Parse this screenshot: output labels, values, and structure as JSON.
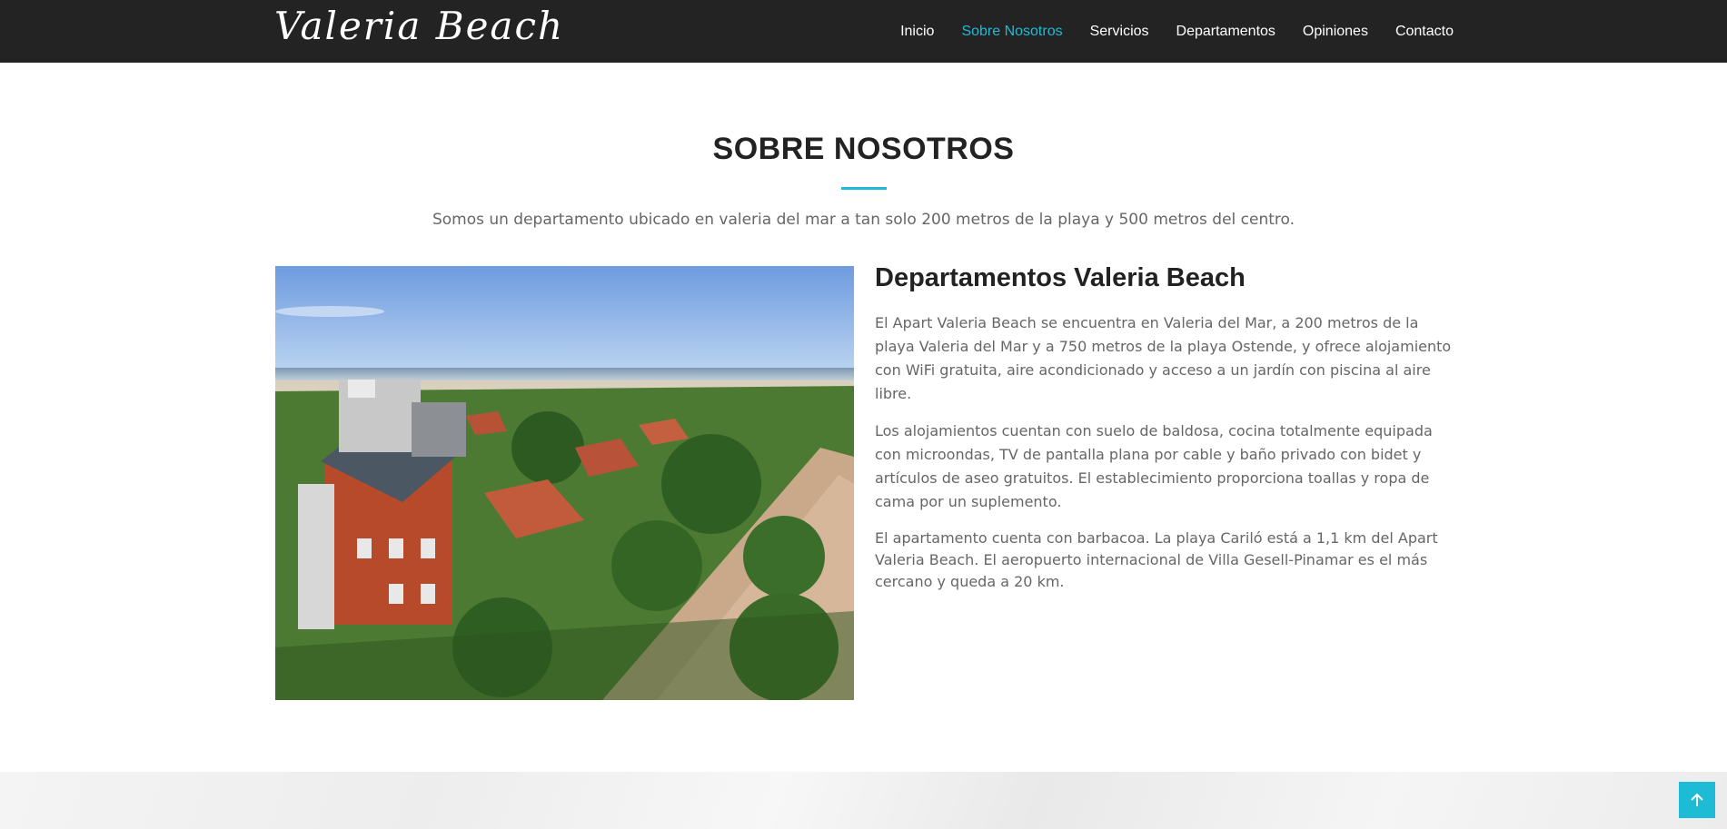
{
  "header": {
    "logo_text": "Valeria Beach",
    "nav": [
      {
        "label": "Inicio",
        "active": false
      },
      {
        "label": "Sobre Nosotros",
        "active": true
      },
      {
        "label": "Servicios",
        "active": false
      },
      {
        "label": "Departamentos",
        "active": false
      },
      {
        "label": "Opiniones",
        "active": false
      },
      {
        "label": "Contacto",
        "active": false
      }
    ]
  },
  "about": {
    "title": "SOBRE NOSOTROS",
    "subtitle": "Somos un departamento ubicado en valeria del mar a tan solo 200 metros de la playa y 500 metros del centro.",
    "heading": "Departamentos Valeria Beach",
    "paragraphs": [
      "El Apart Valeria Beach se encuentra en Valeria del Mar, a 200 metros de la playa Valeria del Mar y a 750 metros de la playa Ostende, y ofrece alojamiento con WiFi gratuita, aire acondicionado y acceso a un jardín con piscina al aire libre.",
      "Los alojamientos cuentan con suelo de baldosa, cocina totalmente equipada con microondas, TV de pantalla plana por cable y baño privado con bidet y artículos de aseo gratuitos. El establecimiento proporciona toallas y ropa de cama por un suplemento.",
      "El apartamento cuenta con barbacoa. La playa Cariló está a 1,1 km del Apart Valeria Beach. El aeropuerto internacional de Villa Gesell-Pinamar es el más cercano y queda a 20 km."
    ]
  },
  "colors": {
    "accent": "#1ebbd7",
    "topbar": "#232323"
  },
  "icons": {
    "back_to_top": "arrow-up-icon"
  }
}
